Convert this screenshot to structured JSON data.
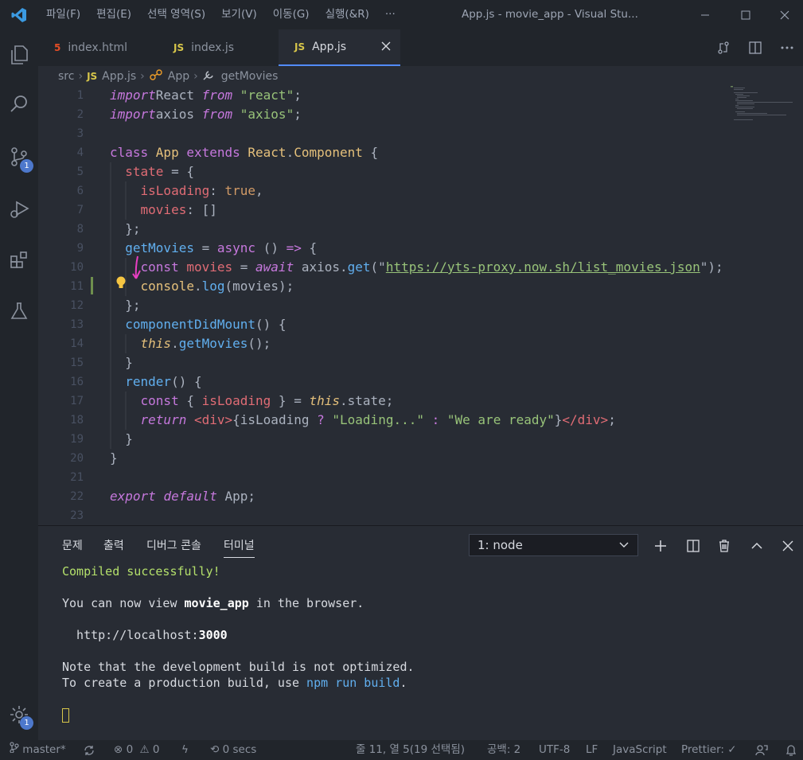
{
  "titlebar": {
    "menus": [
      "파일(F)",
      "편집(E)",
      "선택 영역(S)",
      "보기(V)",
      "이동(G)",
      "실행(&R)",
      "···"
    ],
    "title": "App.js - movie_app - Visual Stu..."
  },
  "activity": {
    "source_control_badge": "1",
    "settings_badge": "1"
  },
  "tabs": [
    {
      "label": "index.html",
      "icon": "html5-icon"
    },
    {
      "label": "index.js",
      "icon": "js-icon"
    },
    {
      "label": "App.js",
      "icon": "js-icon"
    }
  ],
  "tab_icon_text": {
    "html": "5",
    "js": "JS"
  },
  "breadcrumb": {
    "folder": "src",
    "file": "App.js",
    "class": "App",
    "method": "getMovies"
  },
  "editor": {
    "line_numbers": [
      "1",
      "2",
      "3",
      "4",
      "5",
      "6",
      "7",
      "8",
      "9",
      "10",
      "11",
      "12",
      "13",
      "14",
      "15",
      "16",
      "17",
      "18",
      "19",
      "20",
      "21",
      "22",
      "23"
    ],
    "lines": [
      {
        "n": 1,
        "tokens": [
          [
            "kwi",
            "import"
          ],
          [
            "",
            "React "
          ],
          [
            "kwi",
            "from"
          ],
          [
            "",
            ""
          ],
          [
            "str",
            "\"react\""
          ],
          [
            "",
            ";"
          ]
        ]
      },
      {
        "n": 2,
        "tokens": [
          [
            "kwi",
            "import"
          ],
          [
            "",
            "axios "
          ],
          [
            "kwi",
            "from"
          ],
          [
            "",
            ""
          ],
          [
            "str",
            "\"axios\""
          ],
          [
            "",
            ";"
          ]
        ]
      },
      {
        "n": 3,
        "tokens": []
      },
      {
        "n": 4,
        "tokens": [
          [
            "kw",
            "class "
          ],
          [
            "cls",
            "App "
          ],
          [
            "kw",
            "extends "
          ],
          [
            "cls",
            "React"
          ],
          [
            "",
            "."
          ],
          [
            "cls",
            "Component"
          ],
          [
            "",
            " {"
          ]
        ]
      },
      {
        "n": 5,
        "tokens": [
          [
            "",
            "  "
          ],
          [
            "var",
            "state"
          ],
          [
            "",
            " = {"
          ]
        ]
      },
      {
        "n": 6,
        "tokens": [
          [
            "",
            "    "
          ],
          [
            "prop",
            "isLoading"
          ],
          [
            "",
            ": "
          ],
          [
            "num",
            "true"
          ],
          [
            "",
            ","
          ]
        ]
      },
      {
        "n": 7,
        "tokens": [
          [
            "",
            "    "
          ],
          [
            "prop",
            "movies"
          ],
          [
            "",
            ": []"
          ]
        ]
      },
      {
        "n": 8,
        "tokens": [
          [
            "",
            "  };"
          ]
        ]
      },
      {
        "n": 9,
        "tokens": [
          [
            "",
            "  "
          ],
          [
            "fn",
            "getMovies"
          ],
          [
            "",
            " = "
          ],
          [
            "kw",
            "async"
          ],
          [
            "",
            " () "
          ],
          [
            "kw",
            "=>"
          ],
          [
            "",
            " {"
          ]
        ]
      },
      {
        "n": 10,
        "tokens": [
          [
            "",
            "    "
          ],
          [
            "kw",
            "const "
          ],
          [
            "var",
            "movies"
          ],
          [
            "",
            " = "
          ],
          [
            "kwi",
            "await"
          ],
          [
            "",
            " axios."
          ],
          [
            "fn",
            "get"
          ],
          [
            "",
            "(\""
          ],
          [
            "link",
            "https://yts-proxy.now.sh/list_movies.json"
          ],
          [
            "",
            "\");"
          ]
        ]
      },
      {
        "n": 11,
        "tokens": [
          [
            "",
            "    "
          ],
          [
            "cls",
            "console"
          ],
          [
            "",
            "."
          ],
          [
            "fn",
            "log"
          ],
          [
            "",
            "(movies);"
          ]
        ]
      },
      {
        "n": 12,
        "tokens": [
          [
            "",
            "  };"
          ]
        ]
      },
      {
        "n": 13,
        "tokens": [
          [
            "",
            "  "
          ],
          [
            "fn",
            "componentDidMount"
          ],
          [
            "",
            "() {"
          ]
        ]
      },
      {
        "n": 14,
        "tokens": [
          [
            "",
            "    "
          ],
          [
            "thisk",
            "this"
          ],
          [
            "",
            "."
          ],
          [
            "fn",
            "getMovies"
          ],
          [
            "",
            "();"
          ]
        ]
      },
      {
        "n": 15,
        "tokens": [
          [
            "",
            "  }"
          ]
        ]
      },
      {
        "n": 16,
        "tokens": [
          [
            "",
            "  "
          ],
          [
            "fn",
            "render"
          ],
          [
            "",
            "() {"
          ]
        ]
      },
      {
        "n": 17,
        "tokens": [
          [
            "",
            "    "
          ],
          [
            "kw",
            "const "
          ],
          [
            "",
            ""
          ],
          [
            "",
            "{ "
          ],
          [
            "var",
            "isLoading"
          ],
          [
            "",
            " } = "
          ],
          [
            "thisk",
            "this"
          ],
          [
            "",
            ".state;"
          ]
        ]
      },
      {
        "n": 18,
        "tokens": [
          [
            "",
            "    "
          ],
          [
            "kwi",
            "return "
          ],
          [
            "",
            ""
          ],
          [
            "var",
            "<div>"
          ],
          [
            "",
            "{isLoading "
          ],
          [
            "kw",
            "?"
          ],
          [
            "",
            " "
          ],
          [
            "str",
            "\"Loading...\""
          ],
          [
            "",
            ""
          ],
          [
            "kw",
            " : "
          ],
          [
            "str",
            "\"We are ready\""
          ],
          [
            "",
            "}"
          ],
          [
            "var",
            "</div>"
          ],
          [
            "",
            ";"
          ]
        ]
      },
      {
        "n": 19,
        "tokens": [
          [
            "",
            "  }"
          ]
        ]
      },
      {
        "n": 20,
        "tokens": [
          [
            "",
            "}"
          ]
        ]
      },
      {
        "n": 21,
        "tokens": []
      },
      {
        "n": 22,
        "tokens": [
          [
            "kwi",
            "export "
          ],
          [
            "kwi",
            "default "
          ],
          [
            "",
            "App;"
          ]
        ]
      },
      {
        "n": 23,
        "tokens": []
      }
    ]
  },
  "panel": {
    "tabs": [
      "문제",
      "출력",
      "디버그 콘솔",
      "터미널"
    ],
    "active_tab": "터미널",
    "terminal_select": "1: node",
    "output": {
      "compiled": "Compiled successfully!",
      "view_pre": "You can now view ",
      "app_name": "movie_app",
      "view_post": " in the browser.",
      "url_pre": "  http://localhost:",
      "port": "3000",
      "note": "Note that the development build is not optimized.",
      "build_pre": "To create a production build, use ",
      "build_cmd": "npm run build",
      "build_post": "."
    }
  },
  "status": {
    "branch": "master*",
    "errors": "0",
    "warnings": "0",
    "time": "0 secs",
    "position": "줄 11, 열 5(19 선택됨)",
    "spaces": "공백: 2",
    "encoding": "UTF-8",
    "eol": "LF",
    "language": "JavaScript",
    "prettier": "Prettier: ✓"
  },
  "colors": {
    "accent": "#528bff",
    "badge": "#4d78cc",
    "success": "#b4e06b",
    "lightbulb": "#f5c542"
  }
}
